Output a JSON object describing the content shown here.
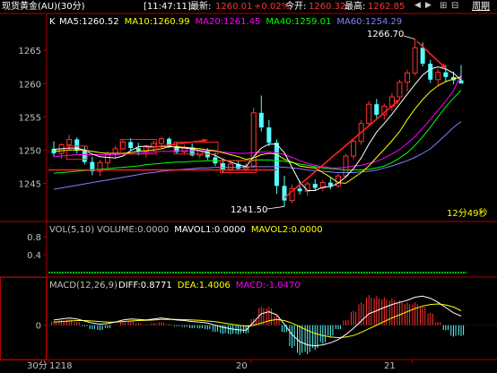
{
  "header": {
    "title": "现货黄金(AU)(30分)",
    "time": "[11:47:11]",
    "last_label": "最新:",
    "last_value": "1260.01",
    "change": "+0.02%",
    "open_label": "今开:",
    "open_value": "1260.32",
    "high_label": "最高:",
    "high_value": "1262.85",
    "period_label": "周期"
  },
  "colors": {
    "up": "#ff3232",
    "down": "#54ffff",
    "ma5": "#ffffff",
    "ma10": "#ffff00",
    "ma20": "#ff00ff",
    "ma40": "#00ff00",
    "ma60": "#8080ff",
    "grid": "#b00000",
    "axis_text": "#c0c0c0"
  },
  "main_panel": {
    "k_label": "K",
    "ma_labels": [
      {
        "text": "MA5:1260.52",
        "color": "ma5"
      },
      {
        "text": "MA10:1260.99",
        "color": "ma10"
      },
      {
        "text": "MA20:1261.45",
        "color": "ma20"
      },
      {
        "text": "MA40:1259.01",
        "color": "ma40"
      },
      {
        "text": "MA60:1254.29",
        "color": "ma60"
      }
    ],
    "high_annotation": "1266.70",
    "low_annotation": "1241.50",
    "countdown": "12分49秒",
    "y_ticks": [
      "1265",
      "1260",
      "1255",
      "1250",
      "1245"
    ]
  },
  "vol_panel": {
    "label": "VOL(5,10)",
    "values": [
      {
        "text": "VOLUME:0.0000",
        "color": "#c0c0c0"
      },
      {
        "text": "MAVOL1:0.0000",
        "color": "#ffffff"
      },
      {
        "text": "MAVOL2:0.0000",
        "color": "#ffff00"
      }
    ],
    "y_ticks": [
      "0.8",
      "0.4"
    ]
  },
  "macd_panel": {
    "label": "MACD(12,26,9)",
    "values": [
      {
        "text": "DIFF:0.8771",
        "color": "#ffffff"
      },
      {
        "text": "DEA:1.4006",
        "color": "#ffff00"
      },
      {
        "text": "MACD:-1.0470",
        "color": "#ff00ff"
      }
    ],
    "y_ticks": [
      "0"
    ]
  },
  "x_axis": {
    "period": "30分",
    "labels": [
      "1218",
      "20",
      "21"
    ]
  },
  "chart_data": {
    "type": "candlestick",
    "title": "现货黄金(AU)(30分)",
    "ylim": [
      1241,
      1268
    ],
    "candles": [
      [
        1250.2,
        1251.3,
        1249.0,
        1249.5
      ],
      [
        1249.5,
        1251.0,
        1248.7,
        1250.8
      ],
      [
        1250.8,
        1252.3,
        1250.0,
        1251.6
      ],
      [
        1251.6,
        1251.9,
        1249.5,
        1249.9
      ],
      [
        1249.9,
        1250.5,
        1247.8,
        1248.2
      ],
      [
        1248.2,
        1249.0,
        1246.2,
        1246.8
      ],
      [
        1246.8,
        1248.5,
        1246.1,
        1248.1
      ],
      [
        1248.1,
        1249.8,
        1247.3,
        1249.5
      ],
      [
        1249.5,
        1250.6,
        1248.7,
        1250.2
      ],
      [
        1250.2,
        1251.5,
        1249.9,
        1251.2
      ],
      [
        1251.2,
        1251.8,
        1249.9,
        1250.3
      ],
      [
        1250.3,
        1251.1,
        1249.2,
        1249.8
      ],
      [
        1249.8,
        1250.7,
        1248.9,
        1250.5
      ],
      [
        1250.5,
        1251.4,
        1249.8,
        1251.0
      ],
      [
        1251.0,
        1252.0,
        1250.3,
        1251.7
      ],
      [
        1251.7,
        1251.9,
        1250.3,
        1250.6
      ],
      [
        1250.6,
        1251.2,
        1249.4,
        1249.7
      ],
      [
        1249.7,
        1250.8,
        1249.3,
        1250.4
      ],
      [
        1250.4,
        1251.0,
        1249.0,
        1249.2
      ],
      [
        1249.2,
        1250.2,
        1248.8,
        1249.9
      ],
      [
        1249.9,
        1250.3,
        1248.5,
        1248.9
      ],
      [
        1248.9,
        1249.6,
        1247.6,
        1248.0
      ],
      [
        1248.0,
        1248.7,
        1246.6,
        1247.1
      ],
      [
        1247.1,
        1248.2,
        1246.8,
        1247.9
      ],
      [
        1247.9,
        1248.3,
        1246.9,
        1247.2
      ],
      [
        1247.2,
        1248.0,
        1246.8,
        1247.6
      ],
      [
        1247.6,
        1256.4,
        1247.3,
        1255.6
      ],
      [
        1255.6,
        1258.2,
        1252.8,
        1253.4
      ],
      [
        1253.4,
        1254.5,
        1250.6,
        1251.1
      ],
      [
        1251.1,
        1251.6,
        1243.4,
        1244.6
      ],
      [
        1244.6,
        1246.1,
        1241.5,
        1242.4
      ],
      [
        1242.4,
        1244.8,
        1242.0,
        1244.2
      ],
      [
        1244.2,
        1245.4,
        1243.3,
        1243.8
      ],
      [
        1243.8,
        1245.3,
        1243.1,
        1244.9
      ],
      [
        1244.9,
        1245.6,
        1243.9,
        1244.3
      ],
      [
        1244.3,
        1245.5,
        1243.8,
        1245.1
      ],
      [
        1245.1,
        1245.8,
        1244.1,
        1244.6
      ],
      [
        1244.6,
        1246.5,
        1244.3,
        1246.1
      ],
      [
        1246.1,
        1249.4,
        1245.8,
        1249.1
      ],
      [
        1249.1,
        1251.6,
        1248.6,
        1251.3
      ],
      [
        1251.3,
        1254.5,
        1250.8,
        1254.0
      ],
      [
        1254.0,
        1257.4,
        1253.6,
        1256.9
      ],
      [
        1256.9,
        1257.7,
        1254.8,
        1255.3
      ],
      [
        1255.3,
        1257.0,
        1254.6,
        1256.6
      ],
      [
        1256.6,
        1258.6,
        1255.9,
        1258.0
      ],
      [
        1258.0,
        1260.6,
        1257.6,
        1260.2
      ],
      [
        1260.2,
        1262.1,
        1258.8,
        1261.6
      ],
      [
        1261.6,
        1266.7,
        1261.2,
        1265.4
      ],
      [
        1265.4,
        1266.2,
        1262.6,
        1263.0
      ],
      [
        1263.0,
        1263.6,
        1260.1,
        1260.6
      ],
      [
        1260.6,
        1262.2,
        1259.8,
        1261.7
      ],
      [
        1261.7,
        1262.8,
        1260.3,
        1261.0
      ],
      [
        1261.0,
        1261.8,
        1259.9,
        1260.5
      ],
      [
        1260.5,
        1262.8,
        1260.2,
        1260.01
      ]
    ],
    "ma": {
      "ma5": [
        1250.1,
        1250.2,
        1250.3,
        1250.3,
        1250.0,
        1249.4,
        1249.0,
        1248.9,
        1248.8,
        1249.1,
        1249.9,
        1250.5,
        1250.6,
        1250.5,
        1250.5,
        1250.6,
        1250.4,
        1250.3,
        1250.2,
        1249.9,
        1249.6,
        1249.2,
        1248.6,
        1248.2,
        1247.8,
        1247.5,
        1249.0,
        1250.3,
        1250.9,
        1250.9,
        1249.6,
        1247.4,
        1245.2,
        1243.9,
        1243.9,
        1244.4,
        1244.5,
        1245.0,
        1246.0,
        1247.2,
        1248.8,
        1250.9,
        1252.7,
        1254.0,
        1255.4,
        1256.9,
        1258.4,
        1259.9,
        1261.3,
        1262.2,
        1262.5,
        1262.2,
        1261.6,
        1260.52
      ],
      "ma10": [
        1249.8,
        1249.9,
        1250.0,
        1250.0,
        1250.0,
        1249.8,
        1249.6,
        1249.5,
        1249.5,
        1249.5,
        1249.6,
        1249.8,
        1249.9,
        1250.0,
        1250.2,
        1250.5,
        1250.5,
        1250.4,
        1250.3,
        1250.2,
        1250.0,
        1249.9,
        1249.6,
        1249.3,
        1249.0,
        1248.6,
        1248.8,
        1249.3,
        1249.5,
        1249.4,
        1248.6,
        1248.2,
        1247.6,
        1247.4,
        1247.3,
        1246.6,
        1245.9,
        1245.1,
        1245.0,
        1245.8,
        1246.6,
        1247.6,
        1248.9,
        1250.1,
        1251.4,
        1252.8,
        1254.6,
        1256.2,
        1257.6,
        1258.8,
        1259.7,
        1260.3,
        1260.7,
        1260.99
      ],
      "ma20": [
        1249.0,
        1249.1,
        1249.2,
        1249.3,
        1249.3,
        1249.3,
        1249.3,
        1249.3,
        1249.3,
        1249.4,
        1249.4,
        1249.5,
        1249.6,
        1249.7,
        1249.8,
        1249.8,
        1249.9,
        1249.9,
        1249.9,
        1249.9,
        1249.9,
        1249.8,
        1249.7,
        1249.6,
        1249.5,
        1249.5,
        1249.6,
        1249.7,
        1249.7,
        1249.6,
        1249.3,
        1248.9,
        1248.4,
        1248.0,
        1247.7,
        1247.5,
        1247.3,
        1247.3,
        1247.4,
        1247.6,
        1247.7,
        1248.0,
        1248.3,
        1248.8,
        1249.4,
        1250.1,
        1251.0,
        1252.0,
        1253.3,
        1254.6,
        1256.0,
        1257.4,
        1258.9,
        1261.45
      ],
      "ma40": [
        1246.5,
        1246.6,
        1246.7,
        1246.8,
        1246.9,
        1247.0,
        1247.1,
        1247.2,
        1247.3,
        1247.4,
        1247.5,
        1247.6,
        1247.8,
        1247.9,
        1248.0,
        1248.1,
        1248.2,
        1248.2,
        1248.3,
        1248.3,
        1248.4,
        1248.4,
        1248.4,
        1248.4,
        1248.4,
        1248.4,
        1248.5,
        1248.5,
        1248.5,
        1248.4,
        1248.3,
        1248.1,
        1247.9,
        1247.7,
        1247.5,
        1247.3,
        1247.2,
        1247.1,
        1247.0,
        1247.0,
        1247.0,
        1247.1,
        1247.3,
        1247.6,
        1248.1,
        1248.8,
        1249.6,
        1250.7,
        1252.0,
        1253.4,
        1255.0,
        1256.5,
        1257.8,
        1259.01
      ],
      "ma60": [
        1244.1,
        1244.3,
        1244.5,
        1244.7,
        1244.9,
        1245.1,
        1245.3,
        1245.5,
        1245.7,
        1245.9,
        1246.1,
        1246.3,
        1246.5,
        1246.6,
        1246.8,
        1246.9,
        1247.0,
        1247.1,
        1247.2,
        1247.3,
        1247.3,
        1247.4,
        1247.4,
        1247.4,
        1247.4,
        1247.4,
        1247.5,
        1247.5,
        1247.5,
        1247.5,
        1247.4,
        1247.3,
        1247.2,
        1247.0,
        1246.9,
        1246.8,
        1246.7,
        1246.6,
        1246.6,
        1246.6,
        1246.7,
        1246.8,
        1247.0,
        1247.3,
        1247.6,
        1248.0,
        1248.4,
        1248.9,
        1249.5,
        1250.2,
        1251.2,
        1252.3,
        1253.4,
        1254.29
      ]
    },
    "macd": {
      "ylim": [
        -2.8,
        3.0
      ],
      "diff": [
        0.5,
        0.6,
        0.7,
        0.6,
        0.4,
        0.2,
        0.1,
        0.15,
        0.3,
        0.5,
        0.6,
        0.55,
        0.5,
        0.6,
        0.7,
        0.6,
        0.5,
        0.45,
        0.35,
        0.3,
        0.2,
        0.0,
        -0.2,
        -0.35,
        -0.45,
        -0.5,
        0.3,
        1.1,
        1.3,
        1.0,
        0.1,
        -0.9,
        -1.6,
        -1.9,
        -2.0,
        -1.9,
        -1.7,
        -1.4,
        -0.9,
        -0.3,
        0.4,
        1.1,
        1.4,
        1.7,
        2.0,
        2.2,
        2.4,
        2.7,
        2.8,
        2.6,
        2.2,
        1.7,
        1.2,
        0.8771
      ],
      "dea": [
        0.3,
        0.35,
        0.4,
        0.45,
        0.45,
        0.4,
        0.35,
        0.3,
        0.3,
        0.35,
        0.4,
        0.45,
        0.47,
        0.5,
        0.55,
        0.56,
        0.55,
        0.53,
        0.5,
        0.46,
        0.4,
        0.33,
        0.22,
        0.1,
        0.0,
        -0.1,
        -0.02,
        0.2,
        0.42,
        0.55,
        0.45,
        0.2,
        -0.15,
        -0.5,
        -0.8,
        -1.0,
        -1.15,
        -1.2,
        -1.15,
        -1.0,
        -0.7,
        -0.35,
        0.0,
        0.35,
        0.7,
        1.0,
        1.3,
        1.6,
        1.85,
        2.0,
        2.05,
        1.95,
        1.75,
        1.4006
      ],
      "hist": [
        0.4,
        0.5,
        0.6,
        0.3,
        -0.1,
        -0.4,
        -0.5,
        -0.3,
        0.0,
        0.3,
        0.4,
        0.2,
        0.06,
        0.2,
        0.3,
        0.1,
        -0.1,
        -0.16,
        -0.3,
        -0.32,
        -0.4,
        -0.66,
        -0.84,
        -0.9,
        -0.9,
        -0.8,
        0.64,
        1.8,
        1.76,
        0.9,
        -0.7,
        -2.2,
        -2.9,
        -2.8,
        -2.4,
        -1.8,
        -1.1,
        -0.4,
        0.5,
        1.4,
        2.2,
        2.9,
        2.8,
        2.7,
        2.6,
        2.4,
        2.2,
        2.2,
        1.9,
        1.2,
        0.3,
        -0.5,
        -1.1,
        -1.047
      ]
    }
  }
}
